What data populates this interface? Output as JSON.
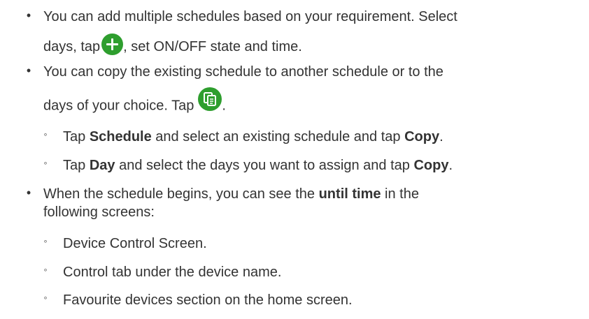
{
  "items": [
    {
      "line1": "You can add multiple schedules based on your requirement. Select",
      "line2_pre": "days, tap",
      "line2_icon": "plus-icon",
      "line2_post": ", set ON/OFF state and time."
    },
    {
      "line1": "You can copy the existing schedule to another schedule or to the",
      "line2_pre": "days of your choice. Tap",
      "line2_icon": "copy-icon",
      "line2_post": ".",
      "subitems": [
        {
          "pre": "Tap ",
          "bold1": "Schedule",
          "mid": " and select an existing schedule and tap ",
          "bold2": "Copy",
          "post": "."
        },
        {
          "pre": "Tap ",
          "bold1": "Day",
          "mid": " and select the days you want to assign and tap ",
          "bold2": "Copy",
          "post": "."
        }
      ]
    },
    {
      "line1_pre": "When the schedule begins, you can see the ",
      "line1_bold": "until time",
      "line1_post": " in the",
      "line2": "following screens:",
      "subitems": [
        "Device Control Screen.",
        "Control tab under the device name.",
        "Favourite devices section on the home screen."
      ]
    }
  ],
  "bullet_char": "•",
  "sub_bullet_char": "◦",
  "colors": {
    "text": "#333333",
    "icon_green": "#2e9e2e",
    "background": "#ffffff"
  }
}
